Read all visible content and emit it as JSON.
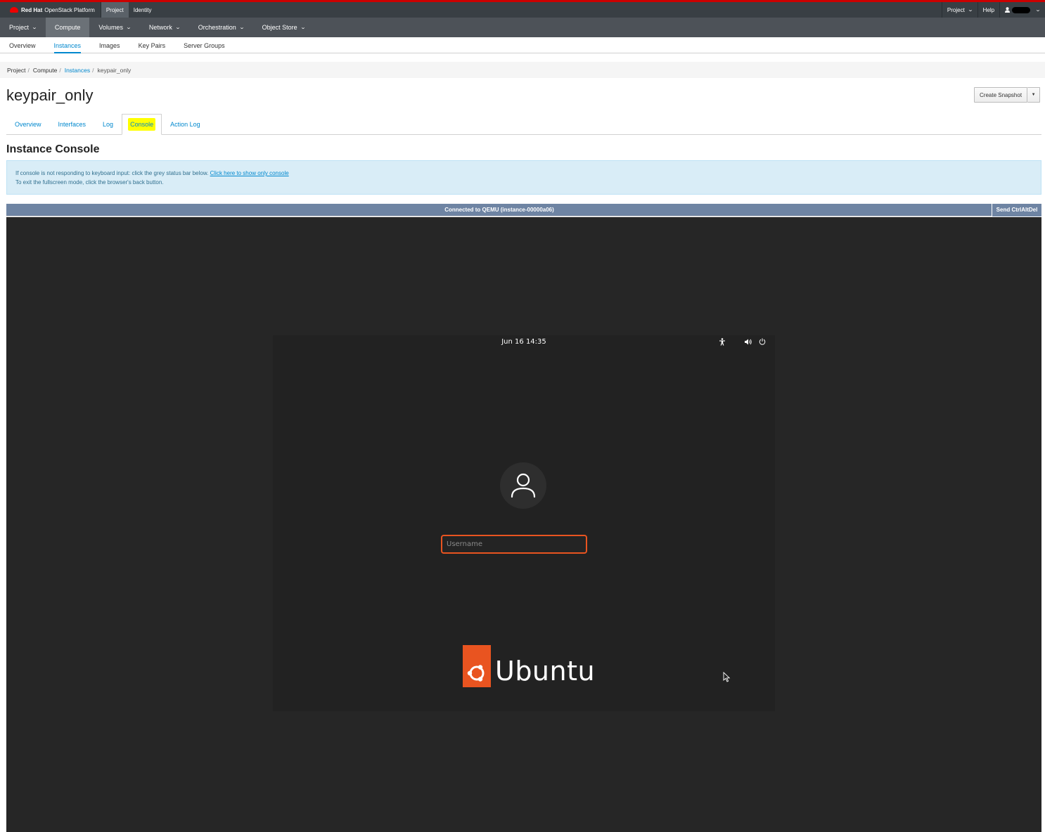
{
  "topbar": {
    "brand_strong": "Red Hat",
    "brand_text": "OpenStack Platform",
    "nav": [
      "Project",
      "Identity"
    ],
    "right": {
      "project_label": "Project",
      "help_label": "Help"
    }
  },
  "primary_nav": {
    "items": [
      "Project",
      "Compute",
      "Volumes",
      "Network",
      "Orchestration",
      "Object Store"
    ],
    "active": "Compute"
  },
  "secondary_nav": {
    "items": [
      "Overview",
      "Instances",
      "Images",
      "Key Pairs",
      "Server Groups"
    ],
    "active": "Instances"
  },
  "breadcrumb": [
    "Project",
    "Compute",
    "Instances",
    "keypair_only"
  ],
  "page": {
    "title": "keypair_only",
    "create_snapshot_label": "Create Snapshot",
    "tabs": [
      "Overview",
      "Interfaces",
      "Log",
      "Console",
      "Action Log"
    ],
    "active_tab": "Console",
    "section_title": "Instance Console"
  },
  "alert": {
    "line1": "If console is not responding to keyboard input: click the grey status bar below. ",
    "link": "Click here to show only console",
    "line2": "To exit the fullscreen mode, click the browser's back button."
  },
  "console": {
    "status": "Connected to QEMU (instance-00000a06)",
    "send_cad_label": "Send CtrlAltDel",
    "vm": {
      "clock": "Jun 16  14:35",
      "username_placeholder": "Username",
      "logo_text": "Ubuntu"
    }
  },
  "colors": {
    "accent": "#0088ce",
    "highlight": "#ffff00",
    "ubuntu_orange": "#e95420",
    "topbar": "#393f44",
    "console_status": "#6e84a3"
  }
}
